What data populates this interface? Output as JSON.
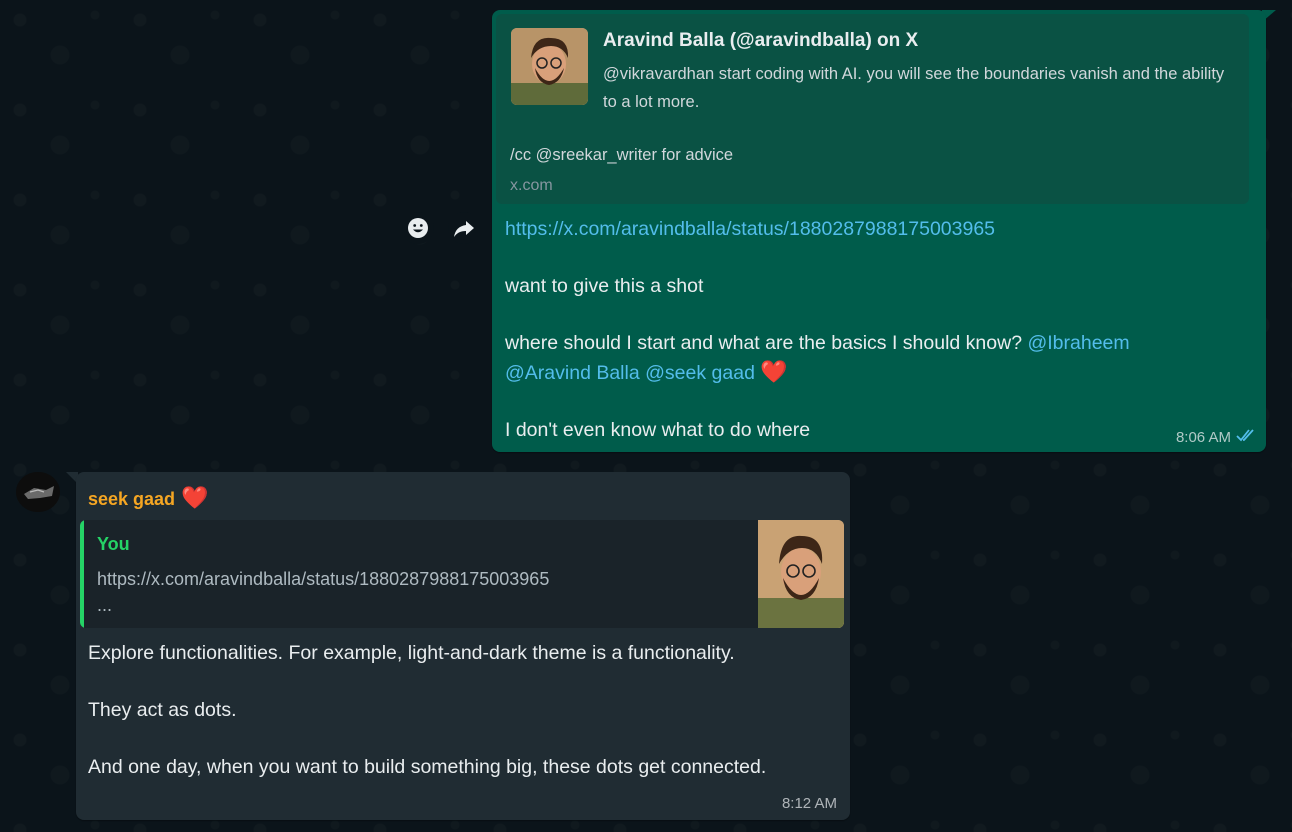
{
  "outgoing": {
    "preview": {
      "title": "Aravind Balla (@aravindballa) on X",
      "description": "@vikravardhan start coding with AI. you will see the boundaries vanish and the ability to a lot more.",
      "cc": "/cc @sreekar_writer for advice",
      "domain": "x.com",
      "thumbnail_icon": "cartoon-avatar"
    },
    "link": "https://x.com/aravindballa/status/1880287988175003965",
    "line1": "want to give this a shot",
    "line2_text": "where should I start and what are the basics I should know?",
    "mention1": "@Ibraheem",
    "mention2": "@Aravind Balla",
    "mention3": "@seek gaad",
    "heart": "❤️",
    "line3": "I don't even know what to do where",
    "time": "8:06 AM",
    "status_icon": "double-check-read-icon"
  },
  "actions": {
    "emoji_icon": "smiley-icon",
    "forward_icon": "forward-arrow-icon"
  },
  "incoming": {
    "sender": "seek gaad",
    "sender_heart": "❤️",
    "quote": {
      "author": "You",
      "text": "https://x.com/aravindballa/status/1880287988175003965",
      "ellipsis": "..."
    },
    "para1": "Explore functionalities. For example, light-and-dark theme is a functionality.",
    "para2": "They act as dots.",
    "para3": "And one day, when you want to build something big, these dots get connected.",
    "time": "8:12 AM"
  },
  "colors": {
    "outgoing_bubble": "#005c4b",
    "incoming_bubble": "#202c33",
    "link": "#53bdeb",
    "sender_name": "#f5a623",
    "quote_accent": "#25d366"
  }
}
